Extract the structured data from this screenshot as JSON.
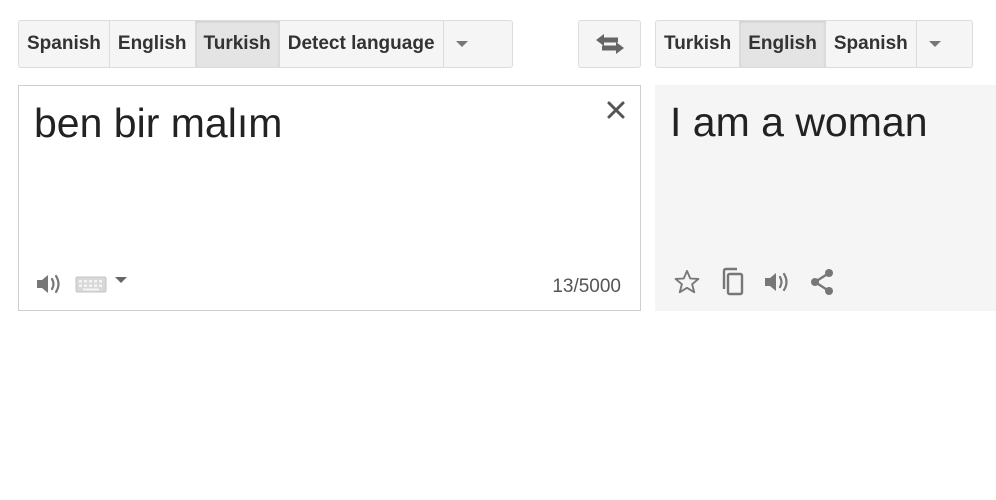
{
  "source_languages": {
    "buttons": [
      "Spanish",
      "English",
      "Turkish",
      "Detect language"
    ],
    "selected": "Turkish"
  },
  "target_languages": {
    "buttons": [
      "Turkish",
      "English",
      "Spanish"
    ],
    "selected": "English"
  },
  "source": {
    "text": "ben bir malım",
    "char_count": "13/5000"
  },
  "target": {
    "text": "I am a woman"
  },
  "icons": {
    "source_dropdown": "chevron-down-icon",
    "target_dropdown": "chevron-down-icon",
    "swap": "swap-arrows-icon",
    "clear": "close-icon",
    "source_listen": "speaker-icon",
    "keyboard": "keyboard-icon",
    "input_tools_dropdown": "chevron-down-icon",
    "star": "star-icon",
    "copy": "copy-icon",
    "target_listen": "speaker-icon",
    "share": "share-icon"
  },
  "colors": {
    "icon_gray": "#777777",
    "selected_bg": "#e4e4e4",
    "button_bg": "#f5f5f5",
    "target_panel_bg": "#f5f5f5"
  }
}
